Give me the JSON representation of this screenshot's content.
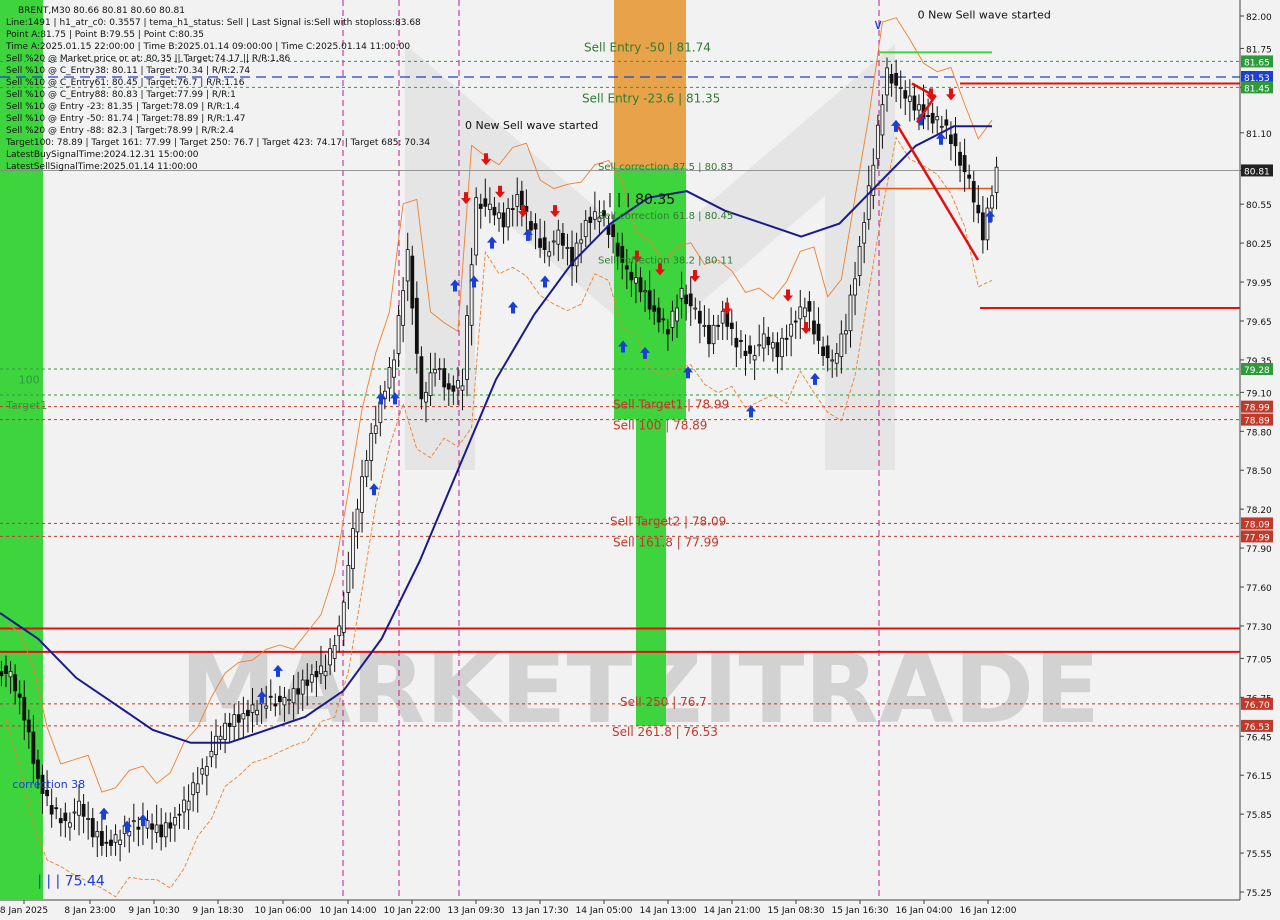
{
  "header": {
    "symbol_line": "BRENT,M30  80.66 80.81 80.60 80.81",
    "info_lines": [
      "Line:1491 | h1_atr_c0: 0.3557 | tema_h1_status: Sell | Last Signal is:Sell with stoploss:83.68",
      "Point A:81.75 | Point B:79.55 | Point C:80.35",
      "Time A:2025.01.15 22:00:00 | Time B:2025.01.14 09:00:00 | Time C:2025.01.14 11:00:00",
      "Sell %20 @ Market price or at: 80.35 || Target:74.17 || R/R:1.86",
      "Sell %10 @ C_Entry38: 80.11 | Target:70.34 | R/R:2.74",
      "Sell %10 @ C_Entry61: 80.45 | Target:76.7 | R/R:1.16",
      "Sell %10 @ C_Entry88: 80.83 | Target:77.99 | R/R:1",
      "Sell %10 @ Entry -23: 81.35 | Target:78.09 | R/R:1.4",
      "Sell %10 @ Entry -50: 81.74 | Target:78.89 | R/R:1.47",
      "Sell %20 @ Entry -88: 82.3 | Target:78.99 | R/R:2.4",
      "Target100: 78.89 | Target 161: 77.99 | Target 250: 76.7 | Target 423: 74.17 | Target 685: 70.34",
      "LatestBuySignalTime:2024.12.31 15:00:00",
      "LatestSellSignalTime:2025.01.14 11:00:00"
    ]
  },
  "chart_data": {
    "type": "candlestick",
    "symbol": "BRENT",
    "timeframe": "M30",
    "ylim": [
      75.2,
      82.1
    ],
    "y_ticks": [
      "82.00",
      "81.75",
      "81.45",
      "81.10",
      "80.81",
      "80.55",
      "80.25",
      "79.95",
      "79.65",
      "79.35",
      "79.10",
      "78.80",
      "78.50",
      "78.20",
      "77.90",
      "77.60",
      "77.30",
      "77.05",
      "76.75",
      "76.45",
      "76.15",
      "75.85",
      "75.55",
      "75.25"
    ],
    "x_ticks": [
      "8 Jan 2025",
      "8 Jan 23:00",
      "9 Jan 10:30",
      "9 Jan 18:30",
      "10 Jan 06:00",
      "10 Jan 14:00",
      "10 Jan 22:00",
      "13 Jan 09:30",
      "13 Jan 17:30",
      "14 Jan 05:00",
      "14 Jan 13:00",
      "14 Jan 21:00",
      "15 Jan 08:30",
      "15 Jan 16:30",
      "16 Jan 04:00",
      "16 Jan 12:00"
    ],
    "close_series": [
      76.9,
      76.6,
      76.1,
      75.9,
      75.8,
      75.9,
      75.7,
      75.6,
      75.7,
      75.8,
      75.75,
      75.7,
      75.8,
      76.0,
      76.2,
      76.4,
      76.55,
      76.6,
      76.7,
      76.75,
      76.7,
      76.8,
      76.9,
      77.0,
      77.3,
      78.0,
      78.6,
      79.0,
      79.4,
      80.2,
      79.0,
      79.3,
      79.1,
      79.2,
      80.6,
      80.5,
      80.4,
      80.6,
      80.4,
      80.2,
      80.3,
      80.1,
      80.4,
      80.5,
      80.3,
      80.0,
      79.9,
      79.7,
      79.6,
      79.9,
      79.7,
      79.5,
      79.7,
      79.5,
      79.4,
      79.5,
      79.4,
      79.6,
      79.8,
      79.5,
      79.3,
      79.6,
      80.2,
      80.9,
      81.6,
      81.4,
      81.3,
      81.2,
      81.2,
      81.0,
      80.7,
      80.3,
      80.81
    ],
    "ema_series": [
      77.4,
      77.2,
      76.9,
      76.7,
      76.5,
      76.4,
      76.4,
      76.5,
      76.6,
      76.8,
      77.2,
      77.8,
      78.5,
      79.2,
      79.7,
      80.1,
      80.4,
      80.6,
      80.65,
      80.5,
      80.4,
      80.3,
      80.4,
      80.7,
      81.0,
      81.15,
      81.15
    ],
    "levels": [
      {
        "label": "Sell Entry -50 | 81.74",
        "value": 81.74
      },
      {
        "label": "Sell Entry -23.6 | 81.35",
        "value": 81.35
      },
      {
        "label": "Sell correction 87.5 | 80.83",
        "value": 80.83
      },
      {
        "label": "Sell correction 61.8 | 80.45",
        "value": 80.45
      },
      {
        "label": "Sell correction 38.2 | 80.11",
        "value": 80.11
      },
      {
        "label": "Sell Target1 | 78.99",
        "value": 78.99
      },
      {
        "label": "Sell 100 | 78.89",
        "value": 78.89
      },
      {
        "label": "Sell Target2 | 78.09",
        "value": 78.09
      },
      {
        "label": "Sell 161.8 | 77.99",
        "value": 77.99
      },
      {
        "label": "Sell  250 | 76.7",
        "value": 76.7
      },
      {
        "label": "Sell 261.8 | 76.53",
        "value": 76.53
      }
    ],
    "price_badges": [
      {
        "text": "81.65",
        "value": 81.65,
        "color": "#2e9b3a"
      },
      {
        "text": "81.53",
        "value": 81.53,
        "color": "#1a3fd6"
      },
      {
        "text": "81.45",
        "value": 81.45,
        "color": "#2e9b3a"
      },
      {
        "text": "80.81",
        "value": 80.81,
        "color": "#222222"
      },
      {
        "text": "79.28",
        "value": 79.28,
        "color": "#2e9b3a"
      },
      {
        "text": "78.99",
        "value": 78.99,
        "color": "#c0392b"
      },
      {
        "text": "78.89",
        "value": 78.89,
        "color": "#c0392b"
      },
      {
        "text": "78.09",
        "value": 78.09,
        "color": "#c0392b"
      },
      {
        "text": "77.99",
        "value": 77.99,
        "color": "#c0392b"
      },
      {
        "text": "76.70",
        "value": 76.7,
        "color": "#c0392b"
      },
      {
        "text": "76.53",
        "value": 76.53,
        "color": "#c0392b"
      }
    ],
    "annotations": [
      {
        "text": "0 New Sell wave started",
        "x_frac": 0.74,
        "value": 81.98
      },
      {
        "text": "0 New Sell wave started",
        "x_frac": 0.375,
        "value": 81.13
      },
      {
        "text": "| | | 80.35",
        "x_frac": 0.49,
        "value": 80.55
      },
      {
        "text": "100",
        "x_frac": 0.015,
        "value": 79.17
      },
      {
        "text": "Target1",
        "x_frac": 0.005,
        "value": 78.97
      },
      {
        "text": "correction 38",
        "x_frac": 0.01,
        "value": 76.05
      },
      {
        "text": "| | | 75.44",
        "x_frac": 0.03,
        "value": 75.3
      }
    ]
  },
  "colors": {
    "background": "#f2f2f2",
    "grid_green": "#2e9b3a",
    "level_red": "#c0392b",
    "ema": "#1a1a8c",
    "band": "#f07f2f",
    "zone_green": "#3dd43d",
    "zone_orange": "#e8a24a",
    "watermark": "#cfcfcf"
  },
  "watermark": "MARKETZITRADE"
}
